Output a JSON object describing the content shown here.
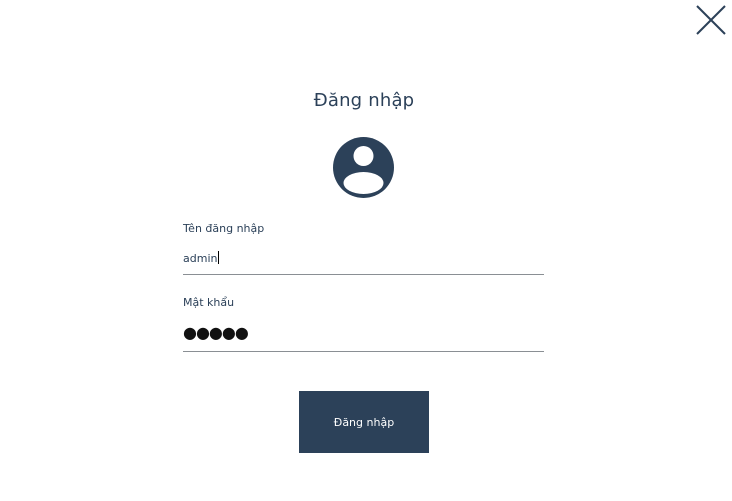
{
  "dialog": {
    "title": "Đăng nhập",
    "close_icon": "close-icon",
    "avatar_icon": "user-avatar-icon"
  },
  "form": {
    "username_label": "Tên đăng nhập",
    "username_value": "admin",
    "password_label": "Mật khẩu",
    "password_value": "●●●●●",
    "submit_label": "Đăng nhập"
  },
  "colors": {
    "primary": "#2c4159",
    "underline": "#8a8f94",
    "background": "#ffffff"
  }
}
